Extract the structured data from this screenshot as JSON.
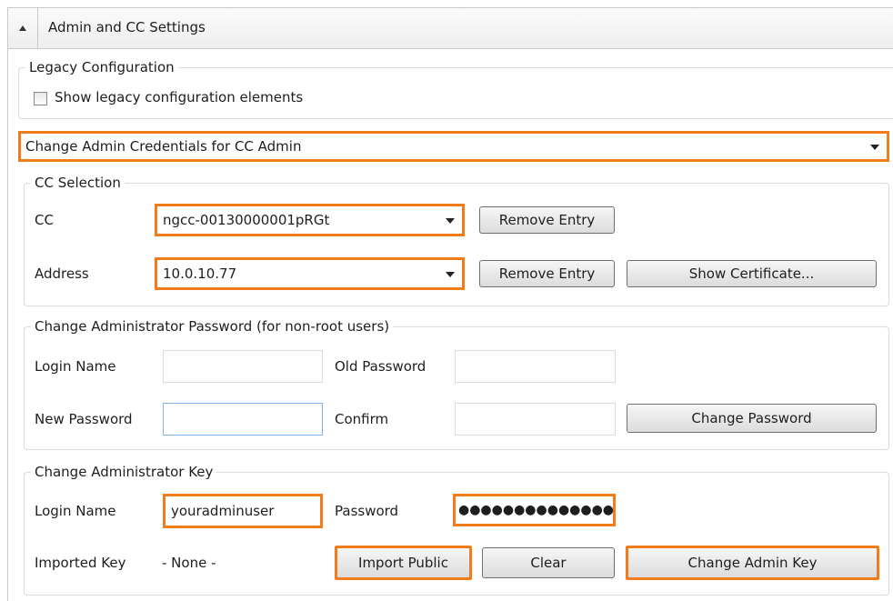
{
  "header": {
    "title": "Admin and CC Settings"
  },
  "legacy": {
    "legend": "Legacy Configuration",
    "checkbox_label": "Show legacy configuration elements",
    "checked": false
  },
  "mode_select": {
    "value": "Change Admin Credentials for CC Admin"
  },
  "cc_selection": {
    "legend": "CC Selection",
    "cc_label": "CC",
    "cc_value": "ngcc-00130000001pRGt",
    "address_label": "Address",
    "address_value": "10.0.10.77",
    "remove_entry_label": "Remove Entry",
    "show_certificate_label": "Show Certificate..."
  },
  "change_password": {
    "legend": "Change Administrator Password (for non-root users)",
    "login_name_label": "Login Name",
    "login_name_value": "",
    "old_password_label": "Old Password",
    "new_password_label": "New Password",
    "confirm_label": "Confirm",
    "change_password_button": "Change Password"
  },
  "change_key": {
    "legend": "Change Administrator Key",
    "login_name_label": "Login Name",
    "login_name_value": "youradminuser",
    "password_label": "Password",
    "password_value": "●●●●●●●●●●●●●●",
    "imported_key_label": "Imported Key",
    "imported_key_value": "- None -",
    "import_public_button": "Import Public",
    "clear_button": "Clear",
    "change_admin_key_button": "Change Admin Key"
  },
  "colors": {
    "highlight": "#f07d1a",
    "group_border": "#d5dbe1"
  }
}
